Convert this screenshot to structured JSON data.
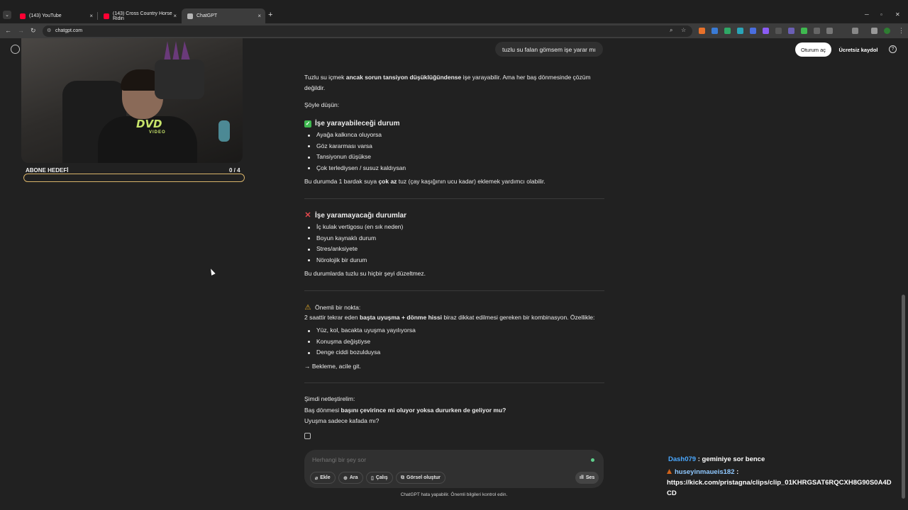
{
  "browser": {
    "tabs": [
      {
        "title": "(143) YouTube",
        "favicon_color": "#ff0033"
      },
      {
        "title": "(143) Cross Country Horse Ridin",
        "favicon_color": "#ff0033"
      },
      {
        "title": "ChatGPT",
        "favicon_color": "#b5b5b5"
      }
    ],
    "url": "chatgpt.com",
    "new_tab_glyph": "+",
    "close_glyph": "×"
  },
  "header": {
    "login_label": "Oturum aç",
    "signup_label": "Ücretsiz kaydol",
    "help_glyph": "?"
  },
  "stream_overlay": {
    "goal_label": "ABONE HEDEFİ",
    "goal_count": "0 / 4",
    "webcam_logo": "DVD",
    "webcam_logo_sub": "VIDEO"
  },
  "conversation": {
    "user_message": "tuzlu su falan gömsem işe yarar mı",
    "answer": {
      "p1_a": "Tuzlu su içmek ",
      "p1_b": "ancak sorun tansiyon düşüklüğündense",
      "p1_c": " işe yarayabilir. Ama her baş dönmesinde çözüm",
      "p1_d": "değildir.",
      "p2": "Şöyle düşün:",
      "section1_title": "İşe yarayabileceği durum",
      "section1_items": [
        "Ayağa kalkınca oluyorsa",
        "Göz kararması varsa",
        "Tansiyonun düşükse",
        "Çok terlediysen / susuz kaldıysan"
      ],
      "p3_a": "Bu durumda 1 bardak suya ",
      "p3_b": "çok az",
      "p3_c": " tuz (çay kaşığının ucu kadar) eklemek yardımcı olabilir.",
      "section2_title": "İşe yaramayacağı durumlar",
      "section2_items": [
        "İç kulak vertigosu (en sık neden)",
        "Boyun kaynaklı durum",
        "Stres/anksiyete",
        "Nörolojik bir durum"
      ],
      "p4": "Bu durumlarda tuzlu su hiçbir şeyi düzeltmez.",
      "note_title": "Önemli bir nokta:",
      "p5_a": "2 saattir tekrar eden ",
      "p5_b": "başta uyuşma + dönme hissi",
      "p5_c": " biraz dikkat edilmesi gereken bir kombinasyon. Özellikle:",
      "section3_items": [
        "Yüz, kol, bacakta uyuşma yayılıyorsa",
        "Konuşma değiştiyse",
        "Denge ciddi bozulduysa"
      ],
      "p6": "→ Bekleme, acile git.",
      "p7": "Şimdi netleştirelim:",
      "p8_a": "Baş dönmesi ",
      "p8_b": "başını çevirince mi oluyor yoksa dururken de geliyor mu?",
      "p9": "Uyuşma sadece kafada mı?"
    }
  },
  "composer": {
    "placeholder": "Herhangi bir şey sor",
    "buttons": [
      "Ekle",
      "Ara",
      "Çalış",
      "Görsel oluştur"
    ],
    "voice_label": "Ses",
    "disclaimer": "ChatGPT hata yapabilir. Önemli bilgileri kontrol edin."
  },
  "stream_chat": [
    {
      "user": "Dash079",
      "message": " : geminiye sor bence"
    },
    {
      "user": "huseyinmaueis182",
      "message": " :",
      "link": "https://kick.com/pristagna/clips/clip_01KHRGSAT6RQCXH8G90S0A4D",
      "link_cont": "CD"
    }
  ],
  "colors": {
    "page_bg": "#212121",
    "bubble_bg": "#303030",
    "check_green": "#3fb950",
    "cross_red": "#e5484d",
    "warning_yellow": "#f0b429",
    "goal_border": "#d9b46a"
  }
}
